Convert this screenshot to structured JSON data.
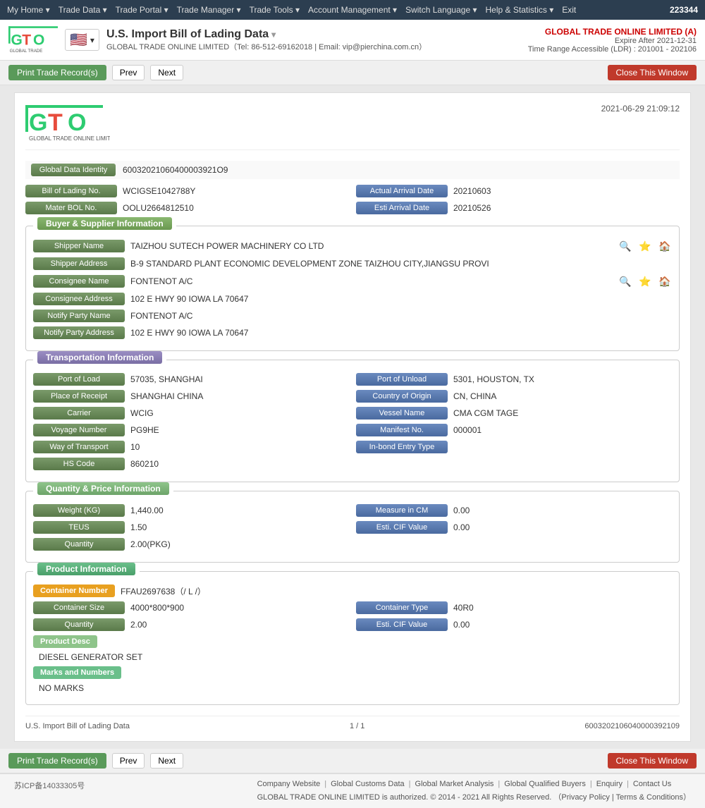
{
  "nav": {
    "items": [
      {
        "label": "My Home",
        "arrow": true
      },
      {
        "label": "Trade Data",
        "arrow": true
      },
      {
        "label": "Trade Portal",
        "arrow": true
      },
      {
        "label": "Trade Manager",
        "arrow": true
      },
      {
        "label": "Trade Tools",
        "arrow": true
      },
      {
        "label": "Account Management",
        "arrow": true
      },
      {
        "label": "Switch Language",
        "arrow": true
      },
      {
        "label": "Help & Statistics",
        "arrow": true
      },
      {
        "label": "Exit",
        "arrow": false
      }
    ],
    "user_id": "223344"
  },
  "header": {
    "title": "U.S. Import Bill of Lading Data",
    "company_info": "GLOBAL TRADE ONLINE LIMITED（Tel: 86-512-69162018 | Email: vip@pierchina.com.cn）",
    "company_name_right": "GLOBAL TRADE ONLINE LIMITED (A)",
    "expire": "Expire After 2021-12-31",
    "time_range": "Time Range Accessible (LDR) : 201001 - 202106"
  },
  "toolbar": {
    "print_label": "Print Trade Record(s)",
    "prev_label": "Prev",
    "next_label": "Next",
    "close_label": "Close This Window"
  },
  "doc": {
    "logo_text": "GTO",
    "logo_sub": "GLOBAL TRADE ONLINE LIMITED",
    "datetime": "2021-06-29 21:09:12",
    "global_data_label": "Global Data Identity",
    "global_data_value": "60032021060400003921O9",
    "bill_of_lading_label": "Bill of Lading No.",
    "bill_of_lading_value": "WCIGSE1042788Y",
    "actual_arrival_label": "Actual Arrival Date",
    "actual_arrival_value": "20210603",
    "mater_bol_label": "Mater BOL No.",
    "mater_bol_value": "OOLU2664812510",
    "esti_arrival_label": "Esti Arrival Date",
    "esti_arrival_value": "20210526",
    "buyer_supplier_section": "Buyer & Supplier Information",
    "shipper_name_label": "Shipper Name",
    "shipper_name_value": "TAIZHOU SUTECH POWER MACHINERY CO LTD",
    "shipper_address_label": "Shipper Address",
    "shipper_address_value": "B-9 STANDARD PLANT ECONOMIC DEVELOPMENT ZONE TAIZHOU CITY,JIANGSU PROVI",
    "consignee_name_label": "Consignee Name",
    "consignee_name_value": "FONTENOT A/C",
    "consignee_address_label": "Consignee Address",
    "consignee_address_value": "102 E HWY 90 IOWA LA 70647",
    "notify_party_name_label": "Notify Party Name",
    "notify_party_name_value": "FONTENOT A/C",
    "notify_party_address_label": "Notify Party Address",
    "notify_party_address_value": "102 E HWY 90 IOWA LA 70647",
    "transport_section": "Transportation Information",
    "port_of_load_label": "Port of Load",
    "port_of_load_value": "57035, SHANGHAI",
    "port_of_unload_label": "Port of Unload",
    "port_of_unload_value": "5301, HOUSTON, TX",
    "place_of_receipt_label": "Place of Receipt",
    "place_of_receipt_value": "SHANGHAI CHINA",
    "country_of_origin_label": "Country of Origin",
    "country_of_origin_value": "CN, CHINA",
    "carrier_label": "Carrier",
    "carrier_value": "WCIG",
    "vessel_name_label": "Vessel Name",
    "vessel_name_value": "CMA CGM TAGE",
    "voyage_number_label": "Voyage Number",
    "voyage_number_value": "PG9HE",
    "manifest_no_label": "Manifest No.",
    "manifest_no_value": "000001",
    "way_of_transport_label": "Way of Transport",
    "way_of_transport_value": "10",
    "in_bond_label": "In-bond Entry Type",
    "in_bond_value": "",
    "hs_code_label": "HS Code",
    "hs_code_value": "860210",
    "quantity_section": "Quantity & Price Information",
    "weight_kg_label": "Weight (KG)",
    "weight_kg_value": "1,440.00",
    "measure_cm_label": "Measure in CM",
    "measure_cm_value": "0.00",
    "teus_label": "TEUS",
    "teus_value": "1.50",
    "esti_cif_label": "Esti. CIF Value",
    "esti_cif_value": "0.00",
    "quantity_label": "Quantity",
    "quantity_value": "2.00(PKG)",
    "product_section": "Product Information",
    "container_number_label": "Container Number",
    "container_number_value": "FFAU2697638（/ L /）",
    "container_size_label": "Container Size",
    "container_size_value": "4000*800*900",
    "container_type_label": "Container Type",
    "container_type_value": "40R0",
    "prod_quantity_label": "Quantity",
    "prod_quantity_value": "2.00",
    "prod_esti_cif_label": "Esti. CIF Value",
    "prod_esti_cif_value": "0.00",
    "product_desc_label": "Product Desc",
    "product_desc_value": "DIESEL GENERATOR SET",
    "marks_and_numbers_label": "Marks and Numbers",
    "marks_and_numbers_value": "NO MARKS",
    "footer_title": "U.S. Import Bill of Lading Data",
    "footer_pages": "1 / 1",
    "footer_id": "6003202106040000392109"
  },
  "footer": {
    "links": [
      {
        "label": "Company Website"
      },
      {
        "label": "Global Customs Data"
      },
      {
        "label": "Global Market Analysis"
      },
      {
        "label": "Global Qualified Buyers"
      },
      {
        "label": "Enquiry"
      },
      {
        "label": "Contact Us"
      }
    ],
    "copyright": "GLOBAL TRADE ONLINE LIMITED is authorized. © 2014 - 2021 All Rights Reserved.",
    "privacy_label": "Privacy Policy",
    "terms_label": "Terms & Conditions",
    "icp": "苏ICP备14033305号"
  }
}
